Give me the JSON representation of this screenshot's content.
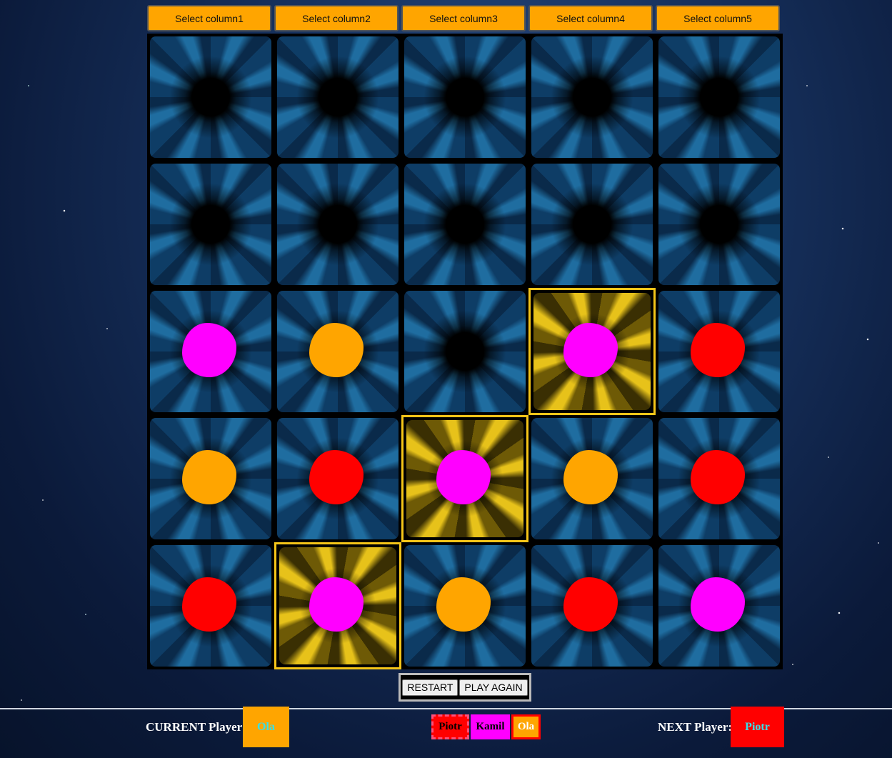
{
  "column_buttons": [
    "Select column1",
    "Select column2",
    "Select column3",
    "Select column4",
    "Select column5"
  ],
  "board": [
    [
      {
        "disc": null,
        "win": false
      },
      {
        "disc": null,
        "win": false
      },
      {
        "disc": null,
        "win": false
      },
      {
        "disc": null,
        "win": false
      },
      {
        "disc": null,
        "win": false
      }
    ],
    [
      {
        "disc": null,
        "win": false
      },
      {
        "disc": null,
        "win": false
      },
      {
        "disc": null,
        "win": false
      },
      {
        "disc": null,
        "win": false
      },
      {
        "disc": null,
        "win": false
      }
    ],
    [
      {
        "disc": "magenta",
        "win": false
      },
      {
        "disc": "orange",
        "win": false
      },
      {
        "disc": null,
        "win": false
      },
      {
        "disc": "magenta",
        "win": true
      },
      {
        "disc": "red",
        "win": false
      }
    ],
    [
      {
        "disc": "orange",
        "win": false
      },
      {
        "disc": "red",
        "win": false
      },
      {
        "disc": "magenta",
        "win": true
      },
      {
        "disc": "orange",
        "win": false
      },
      {
        "disc": "red",
        "win": false
      }
    ],
    [
      {
        "disc": "red",
        "win": false
      },
      {
        "disc": "magenta",
        "win": true
      },
      {
        "disc": "orange",
        "win": false
      },
      {
        "disc": "red",
        "win": false
      },
      {
        "disc": "magenta",
        "win": false
      }
    ]
  ],
  "disc_colors": {
    "magenta": "#ff00ff",
    "orange": "#ffa500",
    "red": "#ff0000"
  },
  "win_border_color": "#f5c518",
  "controls": {
    "restart": "RESTART",
    "play_again": "PLAY AGAIN"
  },
  "footer": {
    "current_label": "CURRENT Player:",
    "current_player": {
      "name": "Ola",
      "color": "#ffa500"
    },
    "next_label": "NEXT Player:",
    "next_player": {
      "name": "Piotr",
      "color": "#ff0000"
    },
    "players": [
      {
        "name": "Piotr",
        "color": "#ff0000"
      },
      {
        "name": "Kamil",
        "color": "#ff00ff"
      },
      {
        "name": "Ola",
        "color": "#ffa500"
      }
    ]
  }
}
